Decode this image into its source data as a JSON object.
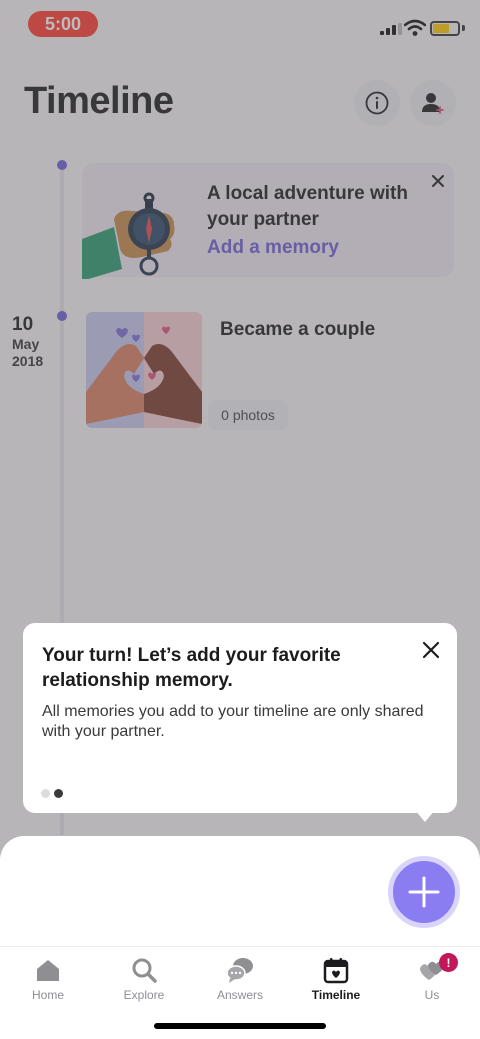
{
  "status_bar": {
    "time": "5:00"
  },
  "header": {
    "title": "Timeline"
  },
  "suggestion_card": {
    "title": "A local adventure with your partner",
    "link": "Add a memory"
  },
  "timeline_entry": {
    "day": "10",
    "month": "May",
    "year": "2018",
    "title": "Became a couple",
    "photos": "0 photos"
  },
  "tooltip": {
    "title": "Your turn! Let’s add your favorite relationship memory.",
    "body": "All memories you add to your timeline are only shared with your partner.",
    "pager": {
      "total": 2,
      "active": 2
    }
  },
  "tabs": [
    {
      "label": "Home",
      "icon": "home-icon",
      "active": false
    },
    {
      "label": "Explore",
      "icon": "search-icon",
      "active": false
    },
    {
      "label": "Answers",
      "icon": "chat-bubbles-icon",
      "active": false
    },
    {
      "label": "Timeline",
      "icon": "calendar-heart-icon",
      "active": true
    },
    {
      "label": "Us",
      "icon": "hearts-icon",
      "active": false
    }
  ],
  "us_badge": "!",
  "colors": {
    "accent": "#6f5fd6",
    "fab": "#8a7df2",
    "status_pill": "#ff3b30",
    "badge": "#c2185b"
  }
}
